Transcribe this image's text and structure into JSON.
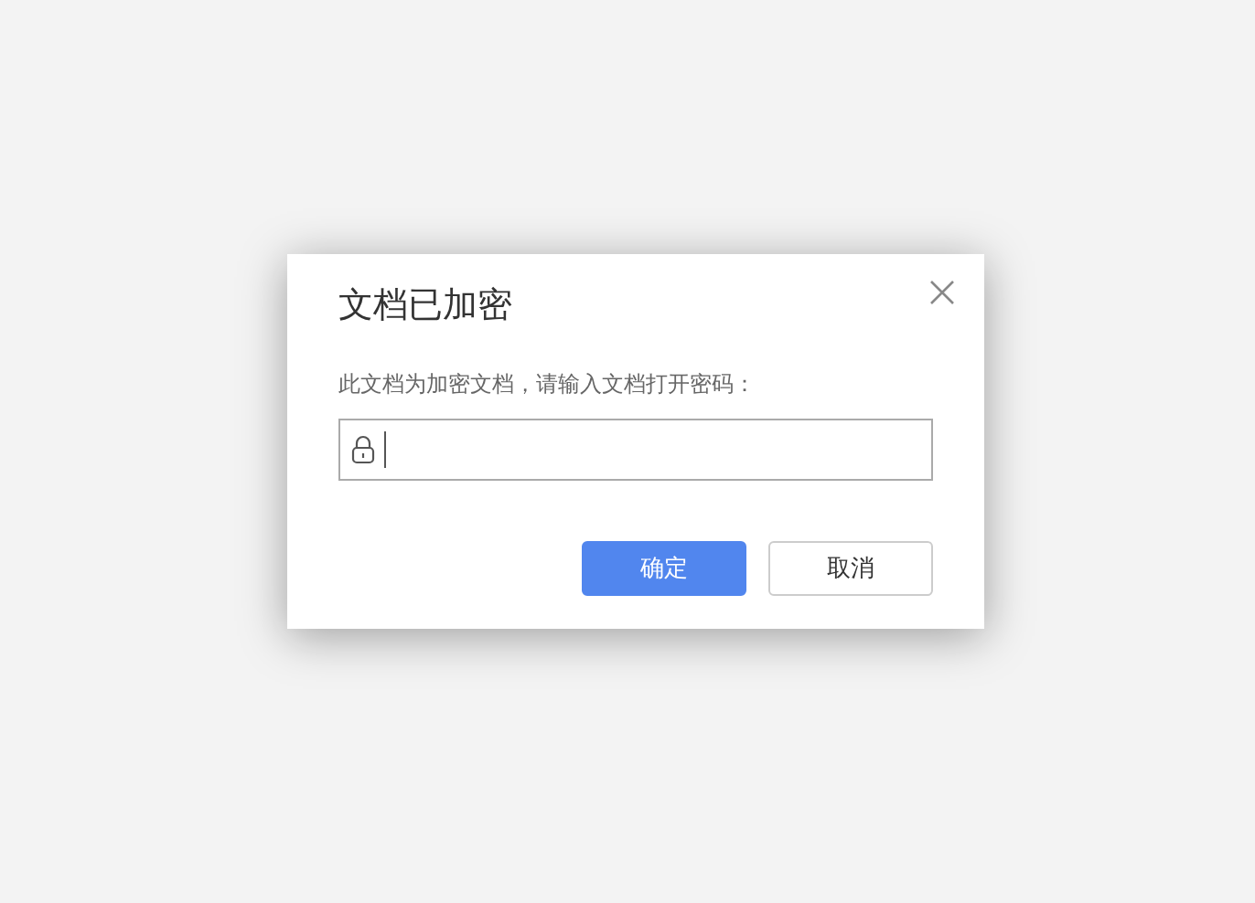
{
  "dialog": {
    "title": "文档已加密",
    "message": "此文档为加密文档，请输入文档打开密码：",
    "buttons": [
      {
        "label": "确定",
        "kind": "primary"
      },
      {
        "label": "取消",
        "kind": "secondary"
      }
    ]
  }
}
